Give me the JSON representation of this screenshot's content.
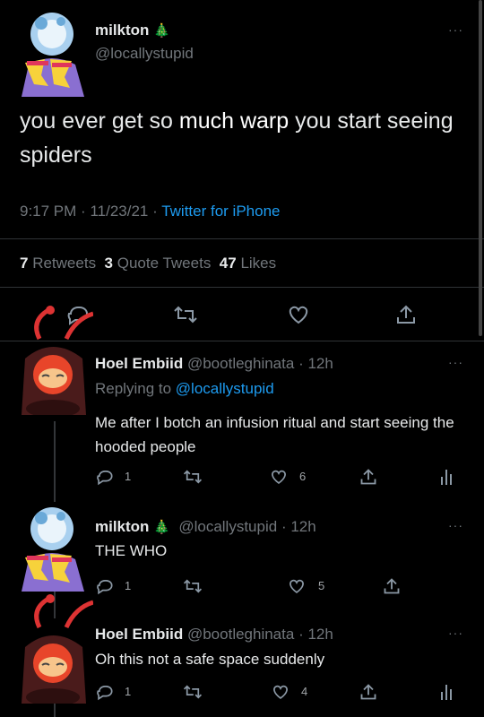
{
  "main_tweet": {
    "name": "milkton",
    "name_emoji": "🎄",
    "handle": "@locallystupid",
    "text_before": "you ever get so ",
    "text_bold": "much warp",
    "text_after": " you start seeing spiders",
    "time": "9:17 PM",
    "sep1": "·",
    "date": "11/23/21",
    "sep2": "·",
    "source": "Twitter for iPhone",
    "retweets_count": "7",
    "retweets_label": "Retweets",
    "quotes_count": "3",
    "quotes_label": "Quote Tweets",
    "likes_count": "47",
    "likes_label": "Likes",
    "more": "···"
  },
  "replies": [
    {
      "name": "Hoel Embiid",
      "handle": "@bootleghinata",
      "time": "· 12h",
      "replying_prefix": "Replying to ",
      "replying_handle": "@locallystupid",
      "text": "Me after I botch an infusion ritual and start seeing the hooded people",
      "reply_count": "1",
      "like_count": "6",
      "more": "···"
    },
    {
      "name": "milkton",
      "name_emoji": "🎄",
      "handle": "@locallystupid",
      "time": "· 12h",
      "text": "THE WHO",
      "reply_count": "1",
      "like_count": "5",
      "more": "···"
    },
    {
      "name": "Hoel Embiid",
      "handle": "@bootleghinata",
      "time": "· 12h",
      "text": "Oh this not a safe space suddenly",
      "reply_count": "1",
      "like_count": "4",
      "more": "···"
    }
  ],
  "colors": {
    "background": "#000000",
    "link": "#1d9bf0",
    "muted": "#71767b"
  }
}
